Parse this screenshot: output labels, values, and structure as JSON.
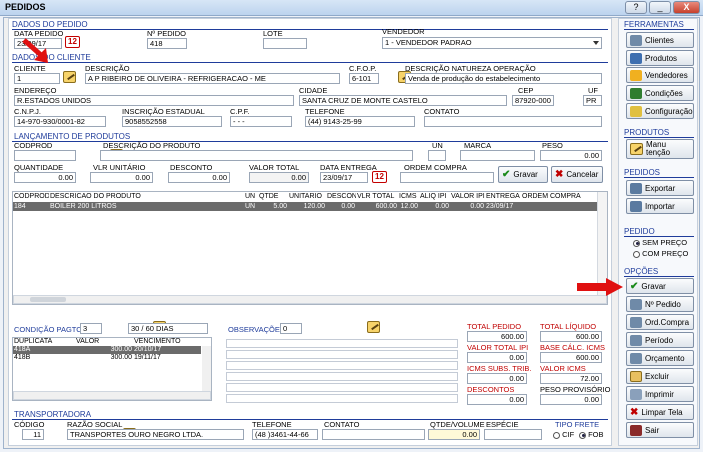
{
  "window": {
    "title": "PEDIDOS",
    "help": "?",
    "minimize": "_",
    "close": "X"
  },
  "pedido": {
    "section": "DADOS DO PEDIDO",
    "data_label": "DATA PEDIDO",
    "data_value": "23/09/17",
    "num_label": "Nº PEDIDO",
    "num_value": "418",
    "lote_label": "LOTE",
    "lote_value": "",
    "vend_label": "VENDEDOR",
    "vend_value": "1 - VENDEDOR PADRAO"
  },
  "cliente": {
    "section": "DADOS DO CLIENTE",
    "cliente_label": "CLIENTE",
    "cliente_value": "1",
    "desc_label": "DESCRIÇÃO",
    "desc_value": "A P RIBEIRO DE OLIVEIRA - REFRIGERACAO - ME",
    "cfop_label": "C.F.O.P.",
    "cfop_value": "6-101",
    "natureza_label": "DESCRIÇÃO NATUREZA OPERAÇÃO",
    "natureza_value": "Venda de produção do estabelecimento",
    "end_label": "ENDEREÇO",
    "end_value": "R.ESTADOS UNIDOS",
    "cidade_label": "CIDADE",
    "cidade_value": "SANTA CRUZ DE MONTE CASTELO",
    "cep_label": "CEP",
    "cep_value": "87920-000",
    "uf_label": "UF",
    "uf_value": "PR",
    "cnpj_label": "C.N.P.J.",
    "cnpj_value": "14-970-930/0001-82",
    "ie_label": "INSCRIÇÃO ESTADUAL",
    "ie_value": "9058552558",
    "cpf_label": "C.P.F.",
    "cpf_value": "-   -   -",
    "tel_label": "TELEFONE",
    "tel_value": "(44) 9143-25-99",
    "contato_label": "CONTATO",
    "contato_value": ""
  },
  "lancamento": {
    "section": "LANÇAMENTO DE PRODUTOS",
    "codprod_label": "CODPROD",
    "desc_label": "DESCRIÇÃO DO PRODUTO",
    "un_label": "UN",
    "marca_label": "MARCA",
    "peso_label": "PESO",
    "peso_value": "0.00",
    "qtd_label": "QUANTIDADE",
    "qtd_value": "0.00",
    "vlr_label": "VLR UNITÁRIO",
    "vlr_value": "0.00",
    "desconto_label": "DESCONTO",
    "desconto_value": "0.00",
    "vtotal_label": "VALOR TOTAL",
    "vtotal_value": "0.00",
    "entrega_label": "DATA ENTREGA",
    "entrega_value": "23/09/17",
    "ordem_label": "ORDEM COMPRA",
    "ordem_value": "",
    "gravar": "Gravar",
    "cancelar": "Cancelar"
  },
  "itens": {
    "headers": [
      "CODPROD",
      "DESCRICAO DO PRODUTO",
      "UN",
      "QTDE",
      "UNITARIO",
      "DESCON",
      "VLR TOTAL",
      "ICMS",
      "ALIQ IPI",
      "VALOR IPI",
      "ENTREGA",
      "ORDEM COMPRA"
    ],
    "rows": [
      [
        "184",
        "BOILER 200 LITROS",
        "UN",
        "5.00",
        "120.00",
        "0.00",
        "600.00",
        "12.00",
        "0.00",
        "0.00",
        "23/09/17",
        ""
      ]
    ]
  },
  "pagto": {
    "cond_label": "CONDIÇÃO PAGTO",
    "cond_num": "3",
    "cond_value": "30 / 60 DIAS",
    "headers": [
      "DUPLICATA",
      "VALOR",
      "VENCIMENTO"
    ],
    "rows": [
      [
        "418A",
        "300.00",
        "20/10/17"
      ],
      [
        "418B",
        "300.00",
        "19/11/17"
      ]
    ]
  },
  "obs": {
    "label": "OBSERVAÇÕES",
    "num": "0"
  },
  "totais": {
    "total_pedido_label": "TOTAL PEDIDO",
    "total_pedido": "600.00",
    "total_liquido_label": "TOTAL LÍQUIDO",
    "total_liquido": "600.00",
    "ipi_label": "VALOR TOTAL IPI",
    "ipi": "0.00",
    "base_icms_label": "BASE CÁLC. ICMS",
    "base_icms": "600.00",
    "icms_subs_label": "ICMS SUBS. TRIB.",
    "icms_subs": "0.00",
    "valor_icms_label": "VALOR ICMS",
    "valor_icms": "72.00",
    "descontos_label": "DESCONTOS",
    "descontos": "0.00",
    "peso_label": "PESO PROVISÓRIO",
    "peso": "0.00"
  },
  "transp": {
    "section": "TRANSPORTADORA",
    "codigo_label": "CÓDIGO",
    "codigo_value": "11",
    "razao_label": "RAZÃO SOCIAL",
    "razao_value": "TRANSPORTES OURO NEGRO LTDA.",
    "tel_label": "TELEFONE",
    "tel_value": "(48 )3461-44-66",
    "contato_label": "CONTATO",
    "contato_value": "",
    "qtde_label": "QTDE/VOLUME",
    "qtde_value": "0.00",
    "especie_label": "ESPÉCIE",
    "especie_value": "",
    "frete_label": "TIPO FRETE",
    "cif": "CIF",
    "fob": "FOB"
  },
  "side": {
    "ferramentas": "FERRAMENTAS",
    "clientes": "Clientes",
    "produtos": "Produtos",
    "vendedores": "Vendedores",
    "condicoes": "Condições",
    "configuracao": "Configuração",
    "produtos_sec": "PRODUTOS",
    "manutencao": "Manu tenção",
    "pedidos_sec": "PEDIDOS",
    "exportar": "Exportar",
    "importar": "Importar",
    "pedido_sec": "PEDIDO",
    "sem_preco": "SEM PREÇO",
    "com_preco": "COM PREÇO",
    "opcoes_sec": "OPÇÕES",
    "gravar": "Gravar",
    "num_pedido": "Nº Pedido",
    "ord_compra": "Ord.Compra",
    "periodo": "Período",
    "orcamento": "Orçamento",
    "excluir": "Excluir",
    "imprimir": "Imprimir",
    "limpar": "Limpar Tela",
    "sair": "Sair"
  },
  "colors": {
    "accent_blue": "#1f3c9b",
    "red_label": "#c00000",
    "arrow": "#e01010"
  }
}
